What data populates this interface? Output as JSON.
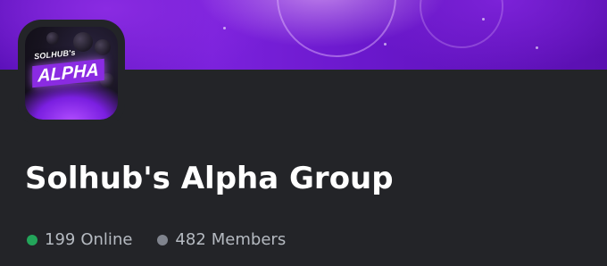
{
  "server": {
    "name": "Solhub's Alpha Group",
    "icon": {
      "small_text": "SOLHUB's",
      "big_text": "ALPHA"
    }
  },
  "stats": {
    "online": {
      "count": "199",
      "label": "Online",
      "color": "#23a55a"
    },
    "members": {
      "count": "482",
      "label": "Members",
      "color": "#80848e"
    }
  },
  "colors": {
    "background": "#232428",
    "banner_accent": "#7b22dc",
    "title": "#ffffff",
    "muted_text": "#b5bac1"
  }
}
